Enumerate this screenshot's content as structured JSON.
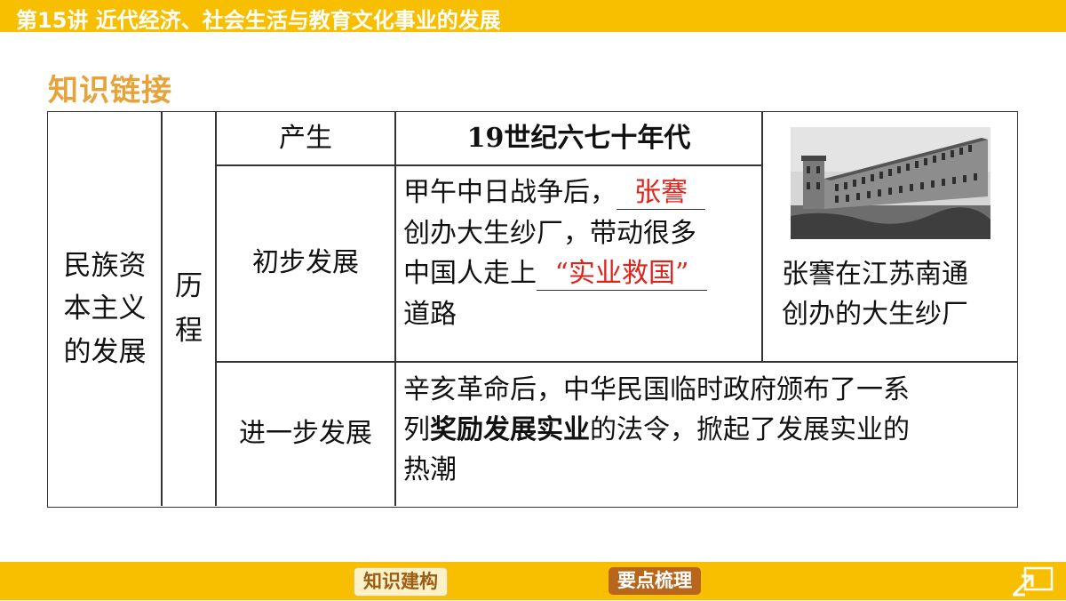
{
  "header": {
    "title": "第15讲  近代经济、社会生活与教育文化事业的发展"
  },
  "section_heading": "知识链接",
  "table": {
    "topic": [
      "民族资",
      "本主义",
      "的发展"
    ],
    "category": [
      "历",
      "程"
    ],
    "row1": {
      "label": "产生",
      "value": "19世纪六七十年代"
    },
    "row2": {
      "label": "初步发展",
      "line1_prefix": "甲午中日战争后，",
      "answer1": "张謇",
      "line2": "创办大生纱厂，带动很多",
      "line3_prefix": "中国人走上",
      "answer2": "“实业救国”",
      "line4": "道路"
    },
    "photo_caption": [
      "张謇在江苏南通",
      "创办的大生纱厂"
    ],
    "row3": {
      "label": "进一步发展",
      "line1": "辛亥革命后，中华民国临时政府颁布了一系",
      "line2_prefix": "列",
      "line2_bold": "奖励发展实业",
      "line2_suffix": "的法令，掀起了发展实业的",
      "line3": "热潮"
    }
  },
  "footer": {
    "btn_knowledge": "知识建构",
    "btn_points": "要点梳理",
    "return_icon": "return-arrow-icon"
  },
  "colors": {
    "bar": "#f7bf00",
    "heading": "#e7a23a",
    "answer": "#e0231c"
  }
}
